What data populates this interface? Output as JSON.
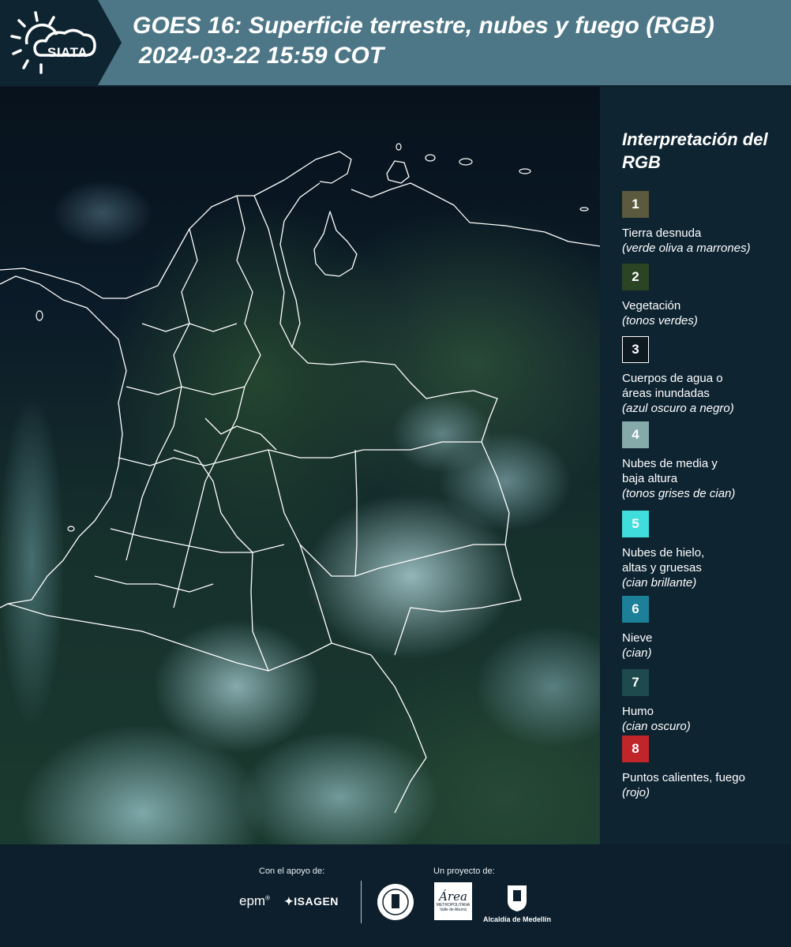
{
  "header": {
    "logo_text": "SIATA",
    "title": "GOES 16: Superficie terrestre, nubes y fuego (RGB)",
    "subtitle": "2024-03-22 15:59 COT"
  },
  "map": {
    "icon": "satellite-rgb-map"
  },
  "legend": {
    "title": "Interpretación del RGB",
    "items": [
      {
        "number": "1",
        "label": "Tierra desnuda",
        "note": "(verde oliva a marrones)",
        "color": "#5c5a3e",
        "border": "#5c5a3e"
      },
      {
        "number": "2",
        "label": "Vegetación",
        "note": "(tonos verdes)",
        "color": "#2b4424",
        "border": "#2b4424"
      },
      {
        "number": "3",
        "label": "Cuerpos de agua o\náreas inundadas",
        "note": "(azul oscuro a negro)",
        "color": "#0e1a22",
        "border": "#ffffff"
      },
      {
        "number": "4",
        "label": "Nubes de media y\nbaja altura",
        "note": "(tonos grises de cian)",
        "color": "#86a9a9",
        "border": "#86a9a9"
      },
      {
        "number": "5",
        "label": "Nubes de hielo,\naltas y gruesas",
        "note": "(cian brillante)",
        "color": "#3fdedd",
        "border": "#3fdedd"
      },
      {
        "number": "6",
        "label": "Nieve",
        "note": "(cian)",
        "color": "#1c8099",
        "border": "#1c8099"
      },
      {
        "number": "7",
        "label": "Humo",
        "note": "(cian oscuro)",
        "color": "#1e4a4d",
        "border": "#1e4a4d"
      },
      {
        "number": "8",
        "label": "Puntos calientes, fuego",
        "note": "(rojo)",
        "color": "#c0252a",
        "border": "#c0252a"
      }
    ]
  },
  "footer": {
    "support_label": "Con el apoyo de:",
    "project_label": "Un proyecto de:",
    "epm": "epm",
    "epm_mark": "®",
    "isagen": "✦ISAGEN",
    "area_script": "Área",
    "area_small": "METROPOLITANA",
    "area_small2": "Valle de Aburrá",
    "alcaldia": "Alcaldía de Medellín"
  }
}
